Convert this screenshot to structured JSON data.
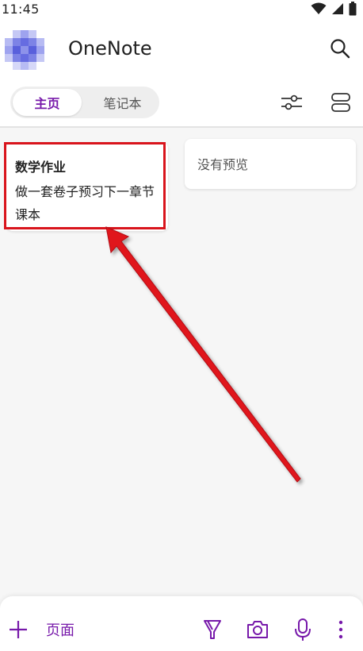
{
  "status_bar": {
    "time": "11:45"
  },
  "header": {
    "title": "OneNote"
  },
  "tabs": [
    {
      "label": "主页",
      "active": true
    },
    {
      "label": "笔记本",
      "active": false
    }
  ],
  "cards": [
    {
      "title": "数学作业",
      "body": "做一套卷子预习下一章节课本",
      "highlighted": true
    },
    {
      "empty_text": "没有预览"
    }
  ],
  "bottom_bar": {
    "add_label": "页面",
    "icons": [
      "add-icon",
      "pen-icon",
      "camera-icon",
      "microphone-icon",
      "more-icon"
    ]
  },
  "colors": {
    "accent": "#7719aa",
    "highlight": "#d9141c",
    "background": "#f6f6f6"
  }
}
